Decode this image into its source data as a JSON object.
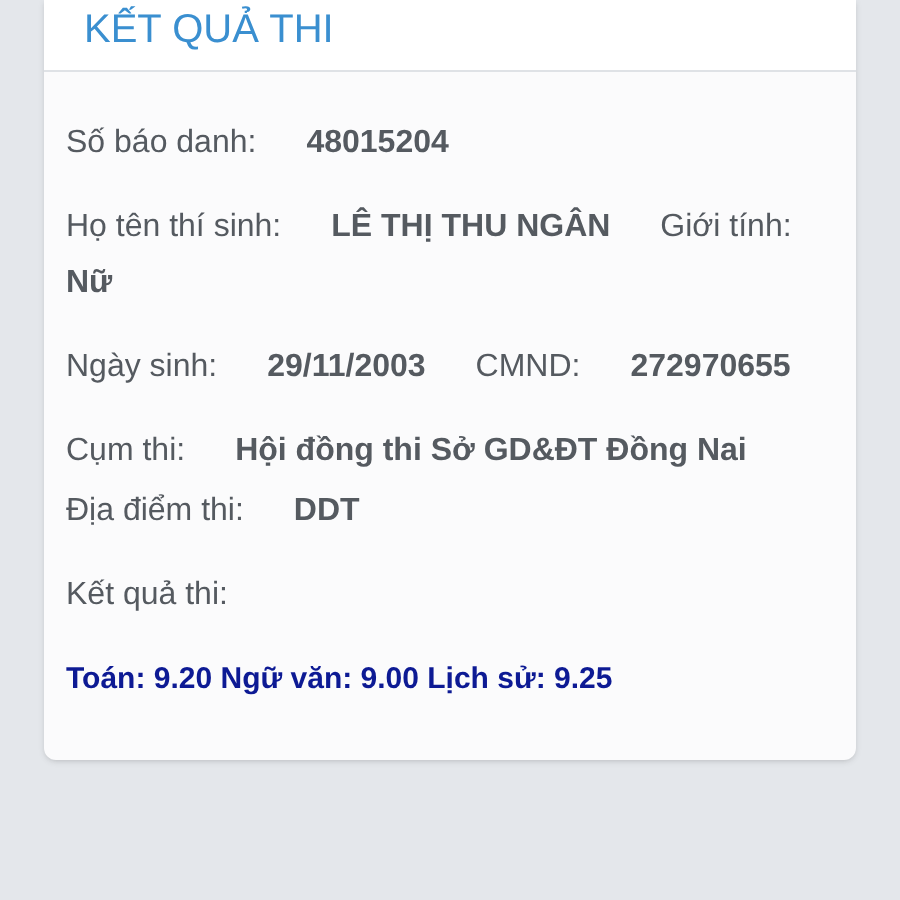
{
  "card": {
    "title": "KẾT QUẢ THI",
    "info_groups": [
      [
        [
          {
            "kind": "label",
            "text": "Số báo danh:"
          },
          {
            "kind": "value",
            "text": "48015204"
          }
        ]
      ],
      [
        [
          {
            "kind": "label",
            "text": "Họ tên thí sinh:"
          },
          {
            "kind": "value",
            "text": "LÊ THỊ THU NGÂN"
          },
          {
            "kind": "label",
            "text": "Giới tính:"
          },
          {
            "kind": "value",
            "text": "Nữ"
          }
        ]
      ],
      [
        [
          {
            "kind": "label",
            "text": "Ngày sinh:"
          },
          {
            "kind": "value",
            "text": "29/11/2003"
          },
          {
            "kind": "label",
            "text": "CMND:"
          },
          {
            "kind": "value",
            "text": "272970655"
          }
        ]
      ],
      [
        [
          {
            "kind": "label",
            "text": "Cụm thi:"
          },
          {
            "kind": "value",
            "text": "Hội đồng thi Sở GD&ĐT Đồng Nai"
          }
        ],
        [
          {
            "kind": "label",
            "text": "Địa điểm thi:"
          },
          {
            "kind": "value",
            "text": "DDT"
          }
        ]
      ],
      [
        [
          {
            "kind": "label",
            "text": "Kết quả thi:"
          }
        ]
      ]
    ],
    "scores": "Toán: 9.20 Ngữ văn: 9.00 Lịch sử: 9.25"
  }
}
